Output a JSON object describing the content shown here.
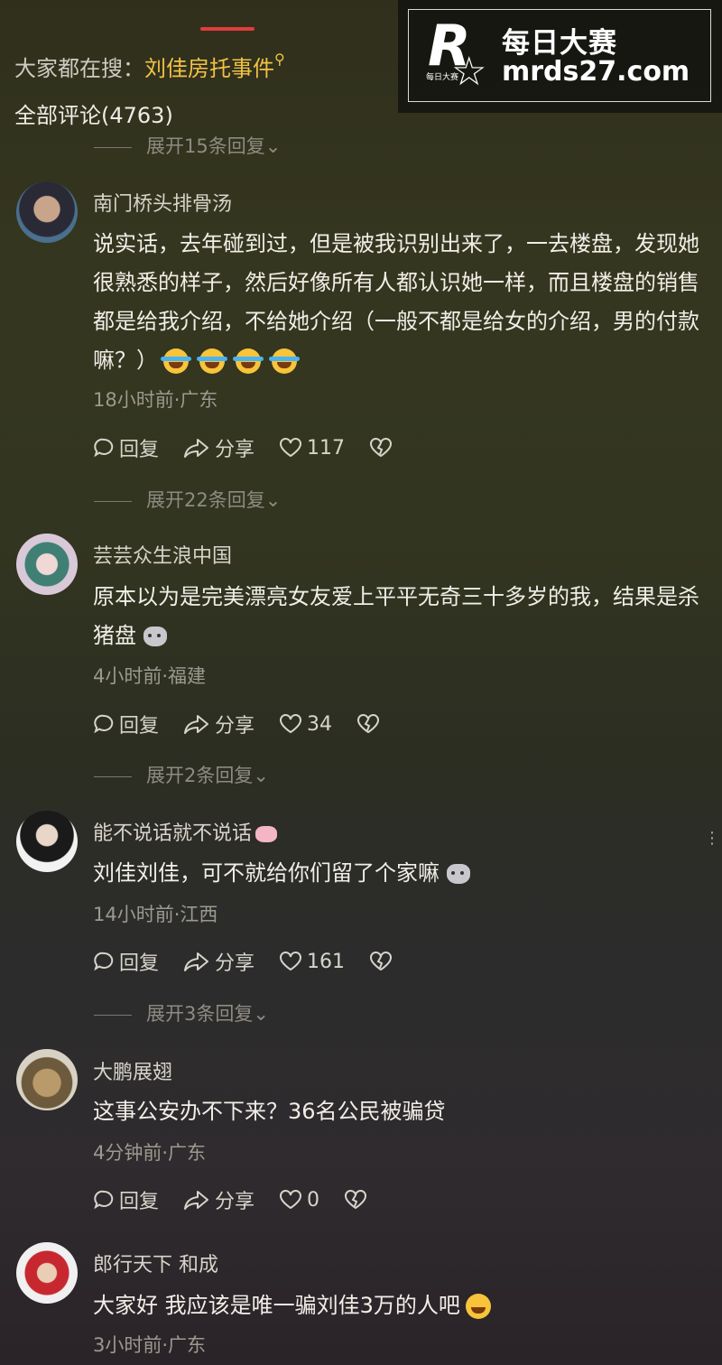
{
  "search": {
    "prefix": "大家都在搜：",
    "keyword": "刘佳房托事件"
  },
  "total_label": "全部评论(4763)",
  "watermark": {
    "letter": "R",
    "sub": "每日大赛",
    "cn": "每日大赛",
    "url": "mrds27.com"
  },
  "expand_top": "展开15条回复",
  "actions": {
    "reply": "回复",
    "share": "分享"
  },
  "comments": [
    {
      "user": "南门桥头排骨汤",
      "text": "说实话，去年碰到过，但是被我识别出来了，一去楼盘，发现她很熟悉的样子，然后好像所有人都认识她一样，而且楼盘的销售都是给我介绍，不给她介绍（一般不都是给女的介绍，男的付款嘛？）",
      "meta": "18小时前·广东",
      "likes": "117",
      "expand": "展开22条回复"
    },
    {
      "user": "芸芸众生浪中国",
      "text": "原本以为是完美漂亮女友爱上平平无奇三十多岁的我，结果是杀猪盘",
      "meta": "4小时前·福建",
      "likes": "34",
      "expand": "展开2条回复"
    },
    {
      "user": "能不说话就不说话",
      "text": "刘佳刘佳，可不就给你们留了个家嘛",
      "meta": "14小时前·江西",
      "likes": "161",
      "expand": "展开3条回复"
    },
    {
      "user": "大鹏展翅",
      "text": "这事公安办不下来？36名公民被骗贷",
      "meta": "4分钟前·广东",
      "likes": "0"
    },
    {
      "user": "郎行天下 和成",
      "text": "大家好 我应该是唯一骗刘佳3万的人吧",
      "meta": "3小时前·广东"
    }
  ]
}
